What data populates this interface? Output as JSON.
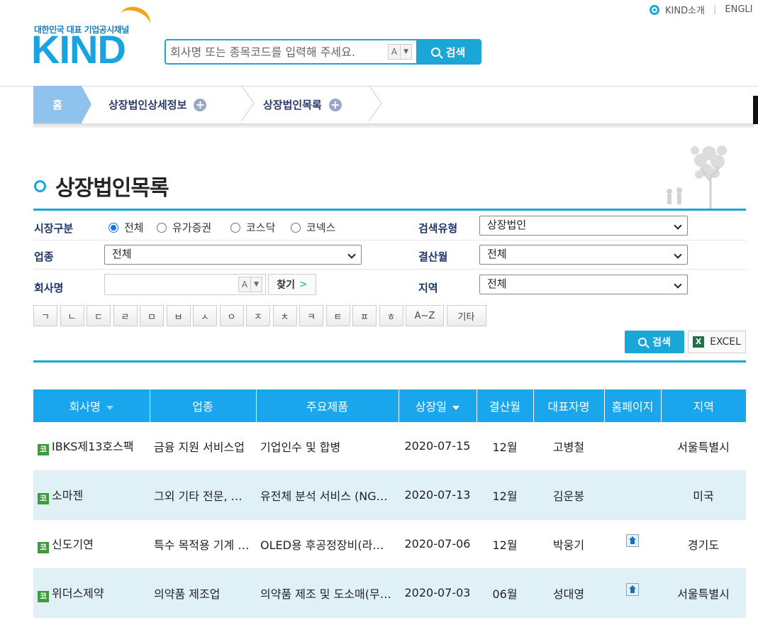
{
  "header": {
    "top_links": [
      "KIND소개",
      "ENGLI"
    ],
    "logo_sub": "대한민국 대표 기업공시채널",
    "logo_main": "KIND",
    "search_placeholder": "회사명 또는 종목코드를 입력해 주세요.",
    "ime_label": "A",
    "ime_arrow": "▼",
    "search_button": "검색"
  },
  "breadcrumb": {
    "home": "홈",
    "items": [
      "상장법인상세정보",
      "상장법인목록"
    ],
    "plus": "+"
  },
  "page_title": "상장법인목록",
  "filters": {
    "market_label": "시장구분",
    "market_options": [
      "전체",
      "유가증권",
      "코스닥",
      "코넥스"
    ],
    "market_selected": "전체",
    "search_type_label": "검색유형",
    "search_type_value": "상장법인",
    "industry_label": "업종",
    "industry_value": "전체",
    "fiscal_label": "결산월",
    "fiscal_value": "전체",
    "company_label": "회사명",
    "company_value": "",
    "find_button": "찾기",
    "find_arrow": ">",
    "region_label": "지역",
    "region_value": "전체",
    "consonants": [
      "ㄱ",
      "ㄴ",
      "ㄷ",
      "ㄹ",
      "ㅁ",
      "ㅂ",
      "ㅅ",
      "ㅇ",
      "ㅈ",
      "ㅊ",
      "ㅋ",
      "ㅌ",
      "ㅍ",
      "ㅎ",
      "A~Z",
      "기타"
    ],
    "search_button": "검색",
    "excel_button": "EXCEL",
    "excel_icon_text": "X"
  },
  "table": {
    "headers": [
      "회사명",
      "업종",
      "주요제품",
      "상장일",
      "결산월",
      "대표자명",
      "홈페이지",
      "지역"
    ],
    "market_badge": "코",
    "rows": [
      {
        "name": "IBKS제13호스팩",
        "industry": "금융 지원 서비스업",
        "product": "기업인수 및 합병",
        "date": "2020-07-15",
        "fiscal": "12월",
        "ceo": "고병철",
        "homepage": false,
        "region": "서울특별시"
      },
      {
        "name": "소마젠",
        "industry": "그외 기타 전문, 과학 및 기술 서비스업",
        "product": "유전체 분석 서비스 (NGS, CES, Microarray)",
        "date": "2020-07-13",
        "fiscal": "12월",
        "ceo": "김운봉",
        "homepage": false,
        "region": "미국"
      },
      {
        "name": "신도기연",
        "industry": "특수 목적용 기계 제조업",
        "product": "OLED용 후공정장비(라미네이터)",
        "date": "2020-07-06",
        "fiscal": "12월",
        "ceo": "박웅기",
        "homepage": true,
        "region": "경기도"
      },
      {
        "name": "위더스제약",
        "industry": "의약품 제조업",
        "product": "의약품 제조 및 도소매(무역)",
        "date": "2020-07-03",
        "fiscal": "06월",
        "ceo": "성대영",
        "homepage": true,
        "region": "서울특별시"
      }
    ]
  }
}
